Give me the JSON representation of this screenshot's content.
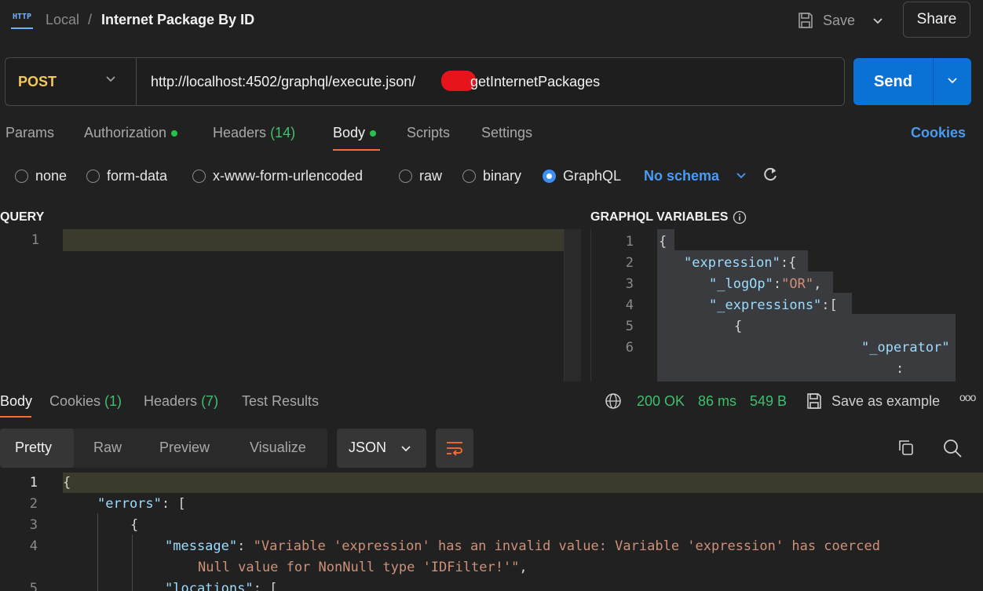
{
  "breadcrumb": {
    "icon": "HTTP",
    "collection": "Local",
    "separator": "/",
    "title": "Internet Package By ID"
  },
  "header": {
    "save_label": "Save",
    "share_label": "Share"
  },
  "request": {
    "method": "POST",
    "url_prefix": "http://localhost:4502/graphql/execute.json/",
    "url_suffix": "getInternetPackages",
    "send_label": "Send"
  },
  "request_tabs": {
    "params": "Params",
    "authorization": "Authorization",
    "headers": "Headers",
    "headers_count": "(14)",
    "body": "Body",
    "scripts": "Scripts",
    "settings": "Settings",
    "cookies": "Cookies"
  },
  "body_types": {
    "none": "none",
    "form_data": "form-data",
    "urlencoded": "x-www-form-urlencoded",
    "raw": "raw",
    "binary": "binary",
    "graphql": "GraphQL",
    "schema": "No schema"
  },
  "query_section": {
    "title": "QUERY",
    "line1": "1"
  },
  "variables_section": {
    "title": "GRAPHQL VARIABLES",
    "lines": [
      "1",
      "2",
      "3",
      "4",
      "5",
      "6"
    ],
    "code": {
      "l1": "{",
      "l2k": "\"expression\"",
      "l2p": ":{",
      "l3k": "\"_logOp\"",
      "l3c": ":",
      "l3v": "\"OR\"",
      "l3e": ",",
      "l4k": "\"_expressions\"",
      "l4p": ":[",
      "l5": "{",
      "l6k": "\"_operator\"",
      "l7": ":"
    }
  },
  "response_tabs": {
    "body": "Body",
    "cookies": "Cookies",
    "cookies_count": "(1)",
    "headers": "Headers",
    "headers_count": "(7)",
    "test_results": "Test Results",
    "status": "200 OK",
    "time": "86 ms",
    "size": "549 B",
    "save_example": "Save as example",
    "more": "ooo"
  },
  "view_bar": {
    "pretty": "Pretty",
    "raw": "Raw",
    "preview": "Preview",
    "visualize": "Visualize",
    "format": "JSON"
  },
  "response_code": {
    "lines": [
      "1",
      "2",
      "3",
      "4",
      "5"
    ],
    "l1": "{",
    "l2k": "\"errors\"",
    "l2p": ": [",
    "l3": "{",
    "l4k": "\"message\"",
    "l4c": ": ",
    "l4v": "\"Variable 'expression' has an invalid value: Variable 'expression' has coerced",
    "l4v2": "Null value for NonNull type 'IDFilter!'\"",
    "l4e": ",",
    "l5k": "\"locations\"",
    "l5p": ": ["
  },
  "colors": {
    "accent": "#ff6c37",
    "send": "#0a72d6",
    "method": "#f5c85c",
    "status_ok": "#3fbf6c",
    "link": "#4a9bf5"
  }
}
